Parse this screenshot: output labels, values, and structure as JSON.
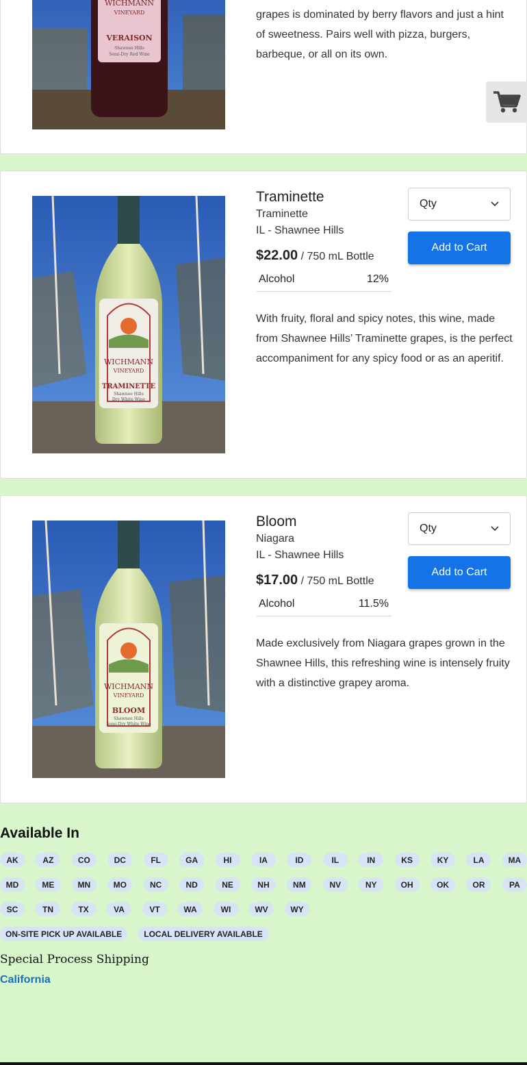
{
  "products": [
    {
      "image_label": {
        "brand": "WICHMANN",
        "sub": "VINEYARD",
        "wine": "VERAISON",
        "region": "Shawnee Hills",
        "style": "Semi-Dry Red Wine"
      },
      "description_tail": "grapes is dominated by berry flavors and just a hint of sweetness. Pairs well with pizza, burgers, barbeque, or all on its own."
    },
    {
      "name": "Traminette",
      "variety": "Traminette",
      "region": "IL - Shawnee Hills",
      "price": "$22.00",
      "unit": "/ 750 mL Bottle",
      "alcohol_label": "Alcohol",
      "alcohol_value": "12%",
      "description": "With fruity, floral and spicy notes, this wine, made from Shawnee Hills’ Traminette grapes, is the perfect accompaniment for any spicy food or as an aperitif.",
      "qty_placeholder": "Qty",
      "cart_label": "Add to Cart",
      "image_label": {
        "brand": "WICHMANN",
        "sub": "VINEYARD",
        "wine": "TRAMINETTE",
        "region": "Shawnee Hills",
        "style": "Dry White Wine"
      }
    },
    {
      "name": "Bloom",
      "variety": "Niagara",
      "region": "IL - Shawnee Hills",
      "price": "$17.00",
      "unit": "/ 750 mL Bottle",
      "alcohol_label": "Alcohol",
      "alcohol_value": "11.5%",
      "description": "Made exclusively from Niagara grapes grown in the Shawnee Hills, this refreshing wine is intensely fruity with a distinctive grapey aroma.",
      "qty_placeholder": "Qty",
      "cart_label": "Add to Cart",
      "image_label": {
        "brand": "WICHMANN",
        "sub": "VINEYARD",
        "wine": "BLOOM",
        "region": "Shawnee Hills",
        "style": "Semi-Dry White Wine"
      }
    }
  ],
  "floating_cart": {
    "icon": "shopping-cart-icon"
  },
  "available": {
    "title": "Available In",
    "rows": [
      [
        "AK",
        "AZ",
        "CO",
        "DC",
        "FL",
        "GA",
        "HI",
        "IA",
        "ID",
        "IL",
        "IN",
        "KS",
        "KY",
        "LA",
        "MA"
      ],
      [
        "MD",
        "ME",
        "MN",
        "MO",
        "NC",
        "ND",
        "NE",
        "NH",
        "NM",
        "NV",
        "NY",
        "OH",
        "OK",
        "OR",
        "PA"
      ],
      [
        "SC",
        "TN",
        "TX",
        "VA",
        "VT",
        "WA",
        "WI",
        "WV",
        "WY"
      ]
    ],
    "services": [
      "ON-SITE PICK UP AVAILABLE",
      "LOCAL DELIVERY AVAILABLE"
    ]
  },
  "shipping": {
    "title": "Special Process Shipping",
    "state": "California"
  },
  "colors": {
    "background": "#d9f5cc",
    "accent": "#1473e6",
    "chip": "#d6e4f5",
    "link": "#1a6fb8"
  }
}
